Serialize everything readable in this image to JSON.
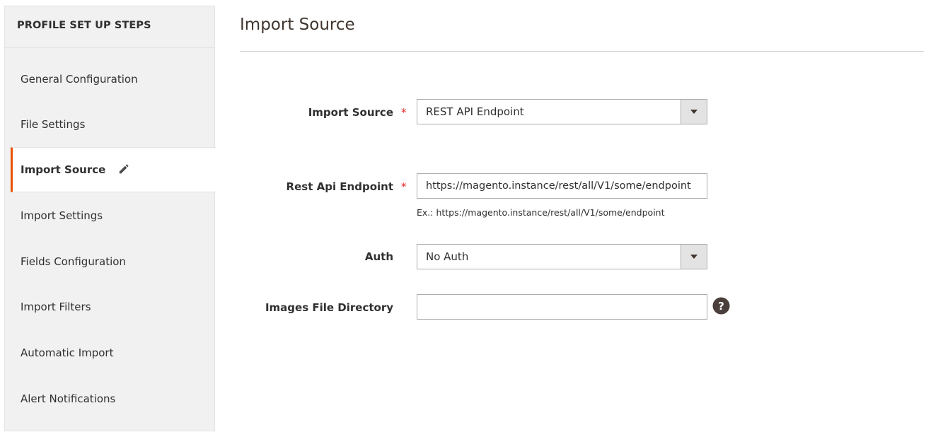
{
  "sidebar": {
    "title": "PROFILE SET UP STEPS",
    "items": [
      {
        "label": "General Configuration"
      },
      {
        "label": "File Settings"
      },
      {
        "label": "Import Source"
      },
      {
        "label": "Import Settings"
      },
      {
        "label": "Fields Configuration"
      },
      {
        "label": "Import Filters"
      },
      {
        "label": "Automatic Import"
      },
      {
        "label": "Alert Notifications"
      }
    ],
    "active_index": 2
  },
  "main": {
    "title": "Import Source",
    "fields": {
      "import_source": {
        "label": "Import Source",
        "required": "*",
        "value": "REST API Endpoint"
      },
      "rest_api_endpoint": {
        "label": "Rest Api Endpoint",
        "required": "*",
        "value": "https://magento.instance/rest/all/V1/some/endpoint",
        "note": "Ex.: https://magento.instance/rest/all/V1/some/endpoint"
      },
      "auth": {
        "label": "Auth",
        "value": "No Auth"
      },
      "images_file_directory": {
        "label": "Images File Directory",
        "value": ""
      }
    }
  },
  "colors": {
    "accent": "#eb5202",
    "required": "#e22626",
    "sidebar_bg": "#f1f1f1"
  },
  "icons": {
    "edit": "pencil-icon",
    "dropdown": "triangle-down-icon",
    "help": "question-circle-icon"
  }
}
